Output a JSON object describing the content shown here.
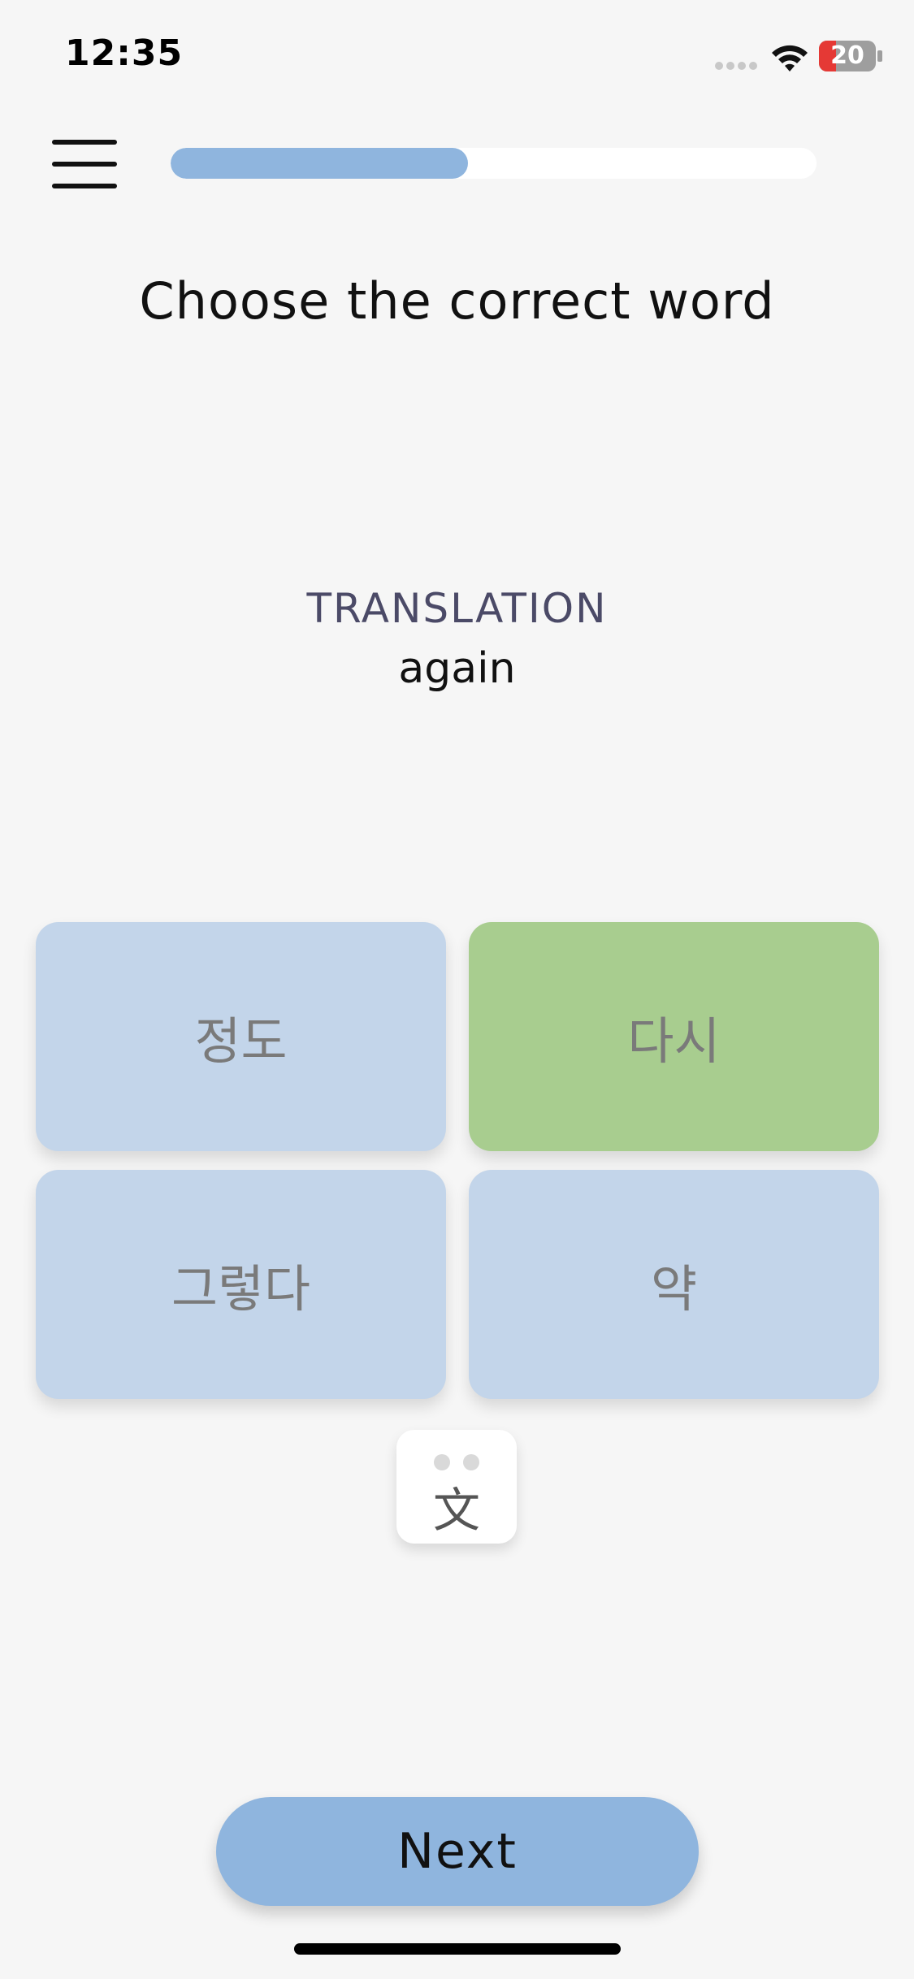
{
  "status_bar": {
    "time": "12:35",
    "battery_level": "20",
    "signal_icon": "signal-dots-icon",
    "wifi_icon": "wifi-icon",
    "battery_icon": "battery-icon",
    "battery_low_color": "#e53935"
  },
  "header": {
    "menu_icon": "hamburger-menu-icon",
    "progress": 0.46,
    "progress_color": "#8fb5de"
  },
  "question": {
    "title": "Choose the correct word",
    "translation_label": "TRANSLATION",
    "translation_word": "again"
  },
  "options": [
    {
      "label": "정도",
      "state": "default"
    },
    {
      "label": "다시",
      "state": "correct"
    },
    {
      "label": "그렇다",
      "state": "default"
    },
    {
      "label": "약",
      "state": "default"
    }
  ],
  "translate_toggle": {
    "glyph": "文",
    "icon": "translate-icon"
  },
  "actions": {
    "next_label": "Next"
  },
  "colors": {
    "option_default": "#c3d5ea",
    "option_correct": "#a8cd8f",
    "accent": "#8fb5de"
  }
}
